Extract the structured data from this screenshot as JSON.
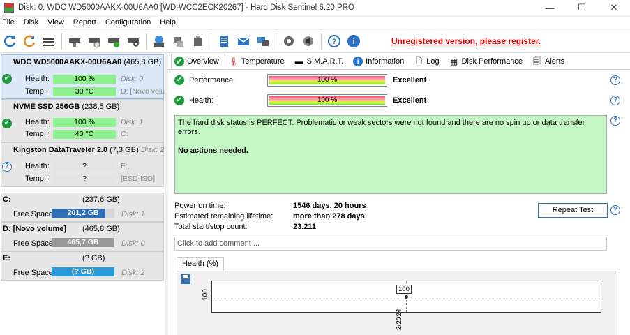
{
  "window": {
    "title": "Disk: 0, WDC WD5000AAKX-00U6AA0 [WD-WCC2ECK20267]  -  Hard Disk Sentinel 6.20 PRO",
    "minimize": "—",
    "maximize": "☐",
    "close": "✕"
  },
  "menu": [
    "File",
    "Disk",
    "View",
    "Report",
    "Configuration",
    "Help"
  ],
  "toolbar": {
    "register_text": "Unregistered version, please register."
  },
  "disks": [
    {
      "name": "WDC WD5000AAKX-00U6AA0",
      "size": "(465,8 GB)",
      "health_label": "Health:",
      "health": "100 %",
      "temp_label": "Temp.:",
      "temp": "30 °C",
      "disk_num": "Disk: 0",
      "volume": "D: [Novo volu",
      "status": "ok"
    },
    {
      "name": "NVME SSD 256GB",
      "size": "(238,5 GB)",
      "health_label": "Health:",
      "health": "100 %",
      "temp_label": "Temp.:",
      "temp": "40 °C",
      "disk_num": "Disk: 1",
      "volume": "C:",
      "status": "ok"
    },
    {
      "name": "Kingston DataTraveler 2.0",
      "size": "(7,3 GB)",
      "disk_tag": "Disk: 2",
      "health_label": "Health:",
      "health": "?",
      "temp_label": "Temp.:",
      "temp": "?",
      "vol1": "E:,",
      "vol2": "[ESD-ISO]",
      "status": "unknown"
    }
  ],
  "volumes": [
    {
      "name": "C:",
      "size": "(237,6 GB)",
      "free_label": "Free Space",
      "free": "201,2 GB",
      "free_fraction": 0.85,
      "disk": "Disk: 1",
      "color": "#2f6fb8"
    },
    {
      "name": "D: [Novo volume]",
      "size": "(465,8 GB)",
      "free_label": "Free Space",
      "free": "465,7 GB",
      "free_fraction": 1.0,
      "disk": "Disk: 0",
      "color": "#999999"
    },
    {
      "name": "E:",
      "size": "(? GB)",
      "free_label": "Free Space",
      "free": "(? GB)",
      "free_fraction": 1.0,
      "disk": "Disk: 2",
      "color": "#2a9ad8"
    }
  ],
  "tabs": [
    {
      "label": "Overview",
      "icon": "check-icon"
    },
    {
      "label": "Temperature",
      "icon": "thermometer-icon"
    },
    {
      "label": "S.M.A.R.T.",
      "icon": "dash-icon"
    },
    {
      "label": "Information",
      "icon": "info-icon"
    },
    {
      "label": "Log",
      "icon": "page-icon"
    },
    {
      "label": "Disk Performance",
      "icon": "chart-icon"
    },
    {
      "label": "Alerts",
      "icon": "pages-icon"
    }
  ],
  "overview": {
    "performance_label": "Performance:",
    "performance_bar": "100 %",
    "performance_value": "Excellent",
    "health_label": "Health:",
    "health_bar": "100 %",
    "health_value": "Excellent",
    "status_text": "The hard disk status is PERFECT. Problematic or weak sectors were not found and there are no spin up or data transfer errors.",
    "actions_text": "No actions needed.",
    "power_on_label": "Power on time:",
    "power_on_value": "1546 days, 20 hours",
    "lifetime_label": "Estimated remaining lifetime:",
    "lifetime_value": "more than 278 days",
    "startstop_label": "Total start/stop count:",
    "startstop_value": "23.211",
    "repeat_button": "Repeat Test",
    "comment_placeholder": "Click to add comment ...",
    "help": "?"
  },
  "chart_data": {
    "type": "line",
    "tab_label": "Health (%)",
    "ytick": "100",
    "xtick": "2/2024",
    "point_label": "100",
    "series": [
      {
        "values": [
          100
        ]
      }
    ]
  }
}
